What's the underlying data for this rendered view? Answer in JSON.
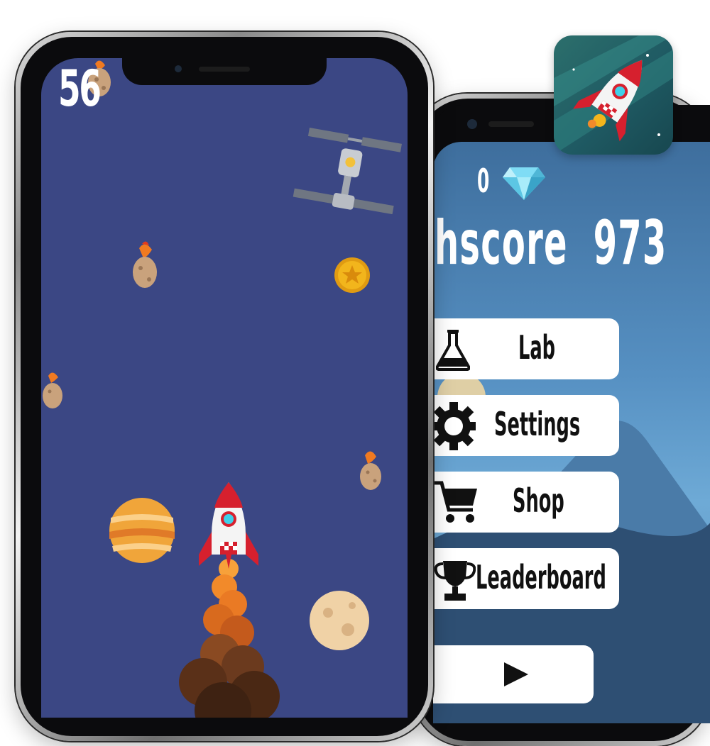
{
  "game": {
    "score": "56"
  },
  "menu": {
    "gems": "0",
    "highscore_label": "hscore",
    "highscore_value": "973",
    "buttons": [
      {
        "label": "Lab",
        "icon": "flask-icon"
      },
      {
        "label": "Settings",
        "icon": "gear-icon"
      },
      {
        "label": "Shop",
        "icon": "cart-icon"
      },
      {
        "label": "Leaderboard",
        "icon": "trophy-icon"
      }
    ],
    "play_icon": "play-icon"
  },
  "colors": {
    "space_bg": "#3b4784",
    "sky_top": "#3e6e9d",
    "sky_mid": "#6eaad6",
    "rocket_red": "#d6202e",
    "coin_gold": "#f2b51c",
    "gem_blue": "#7fdcf5",
    "button_bg": "#ffffff"
  }
}
